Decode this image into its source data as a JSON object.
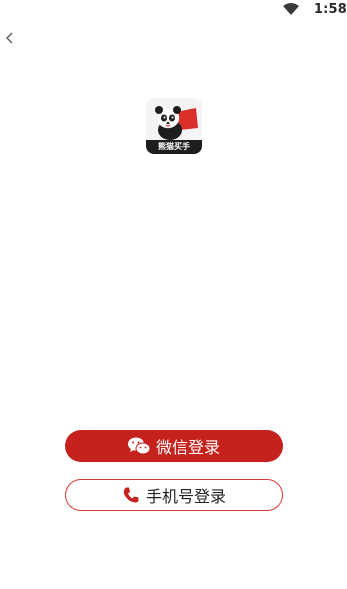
{
  "status_bar": {
    "time": "1:58",
    "wifi_icon": "wifi-icon"
  },
  "header": {
    "back_icon": "chevron-left-icon"
  },
  "logo": {
    "label": "熊猫买手",
    "icon": "panda-mascot-icon"
  },
  "actions": {
    "wechat_login_label": "微信登录",
    "wechat_icon": "wechat-icon",
    "phone_login_label": "手机号登录",
    "phone_icon": "phone-icon"
  },
  "colors": {
    "accent": "#c5221d",
    "phone_border": "#d23c37",
    "text": "#222222",
    "background": "#ffffff"
  }
}
